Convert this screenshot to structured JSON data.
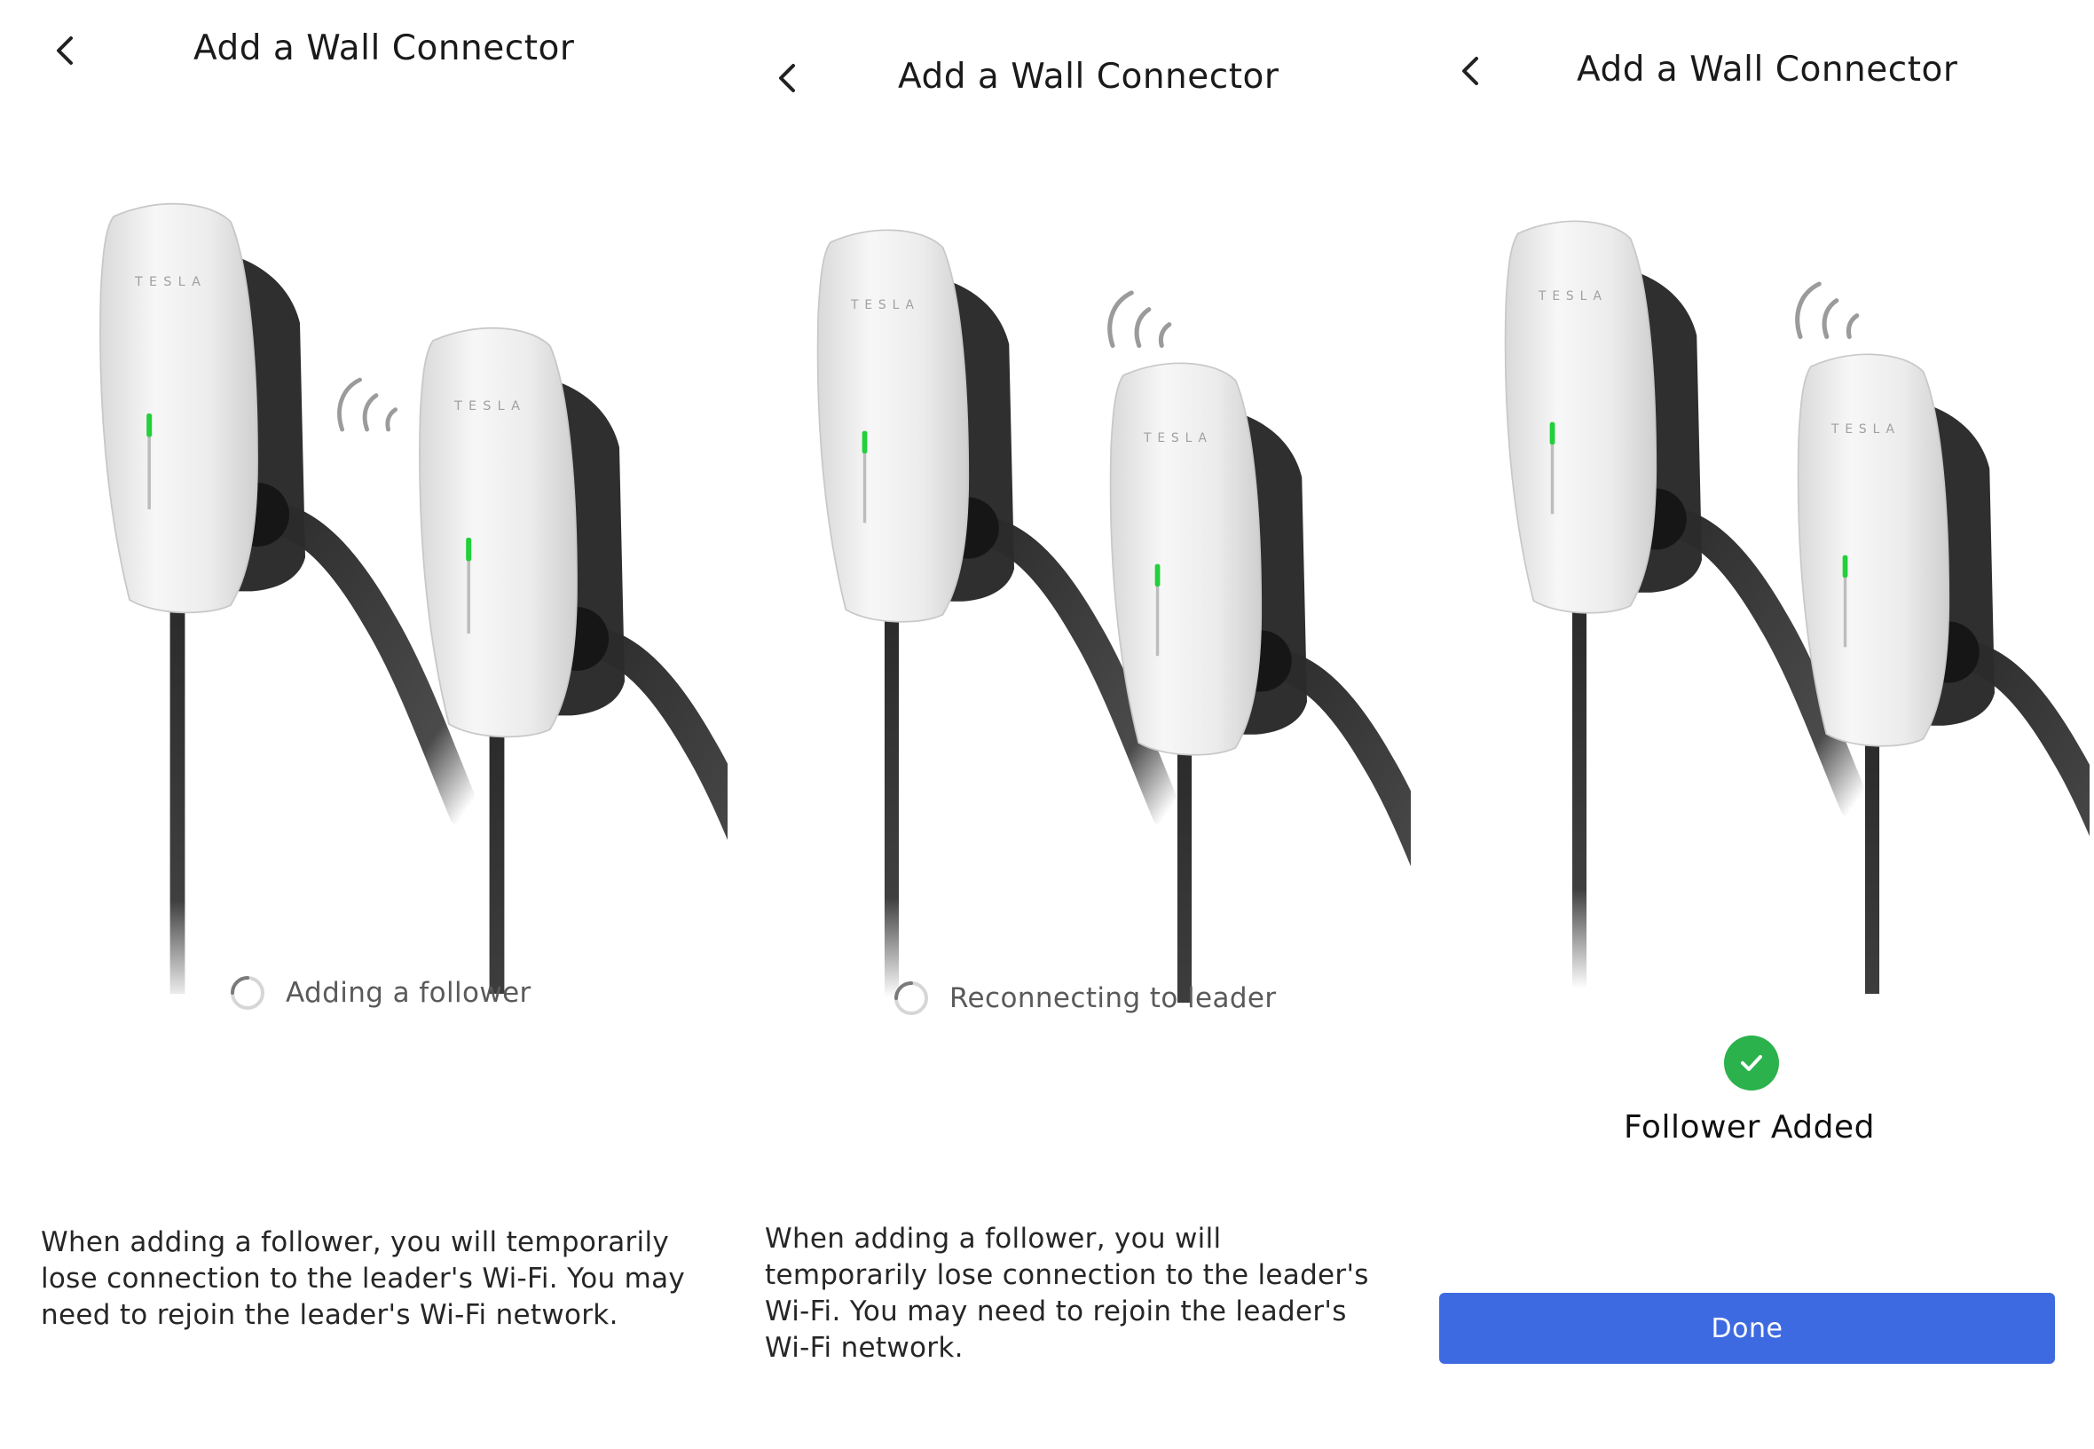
{
  "panels": [
    {
      "header": {
        "title": "Add a Wall Connector",
        "back_icon": "chevron-left-icon"
      },
      "status": {
        "text": "Adding a follower",
        "icon": "loading-spinner-icon"
      },
      "description": "When adding a follower, you will temporarily lose connection to the leader's Wi-Fi. You may need to rejoin the leader's Wi-Fi network."
    },
    {
      "header": {
        "title": "Add a Wall Connector",
        "back_icon": "chevron-left-icon"
      },
      "status": {
        "text": "Reconnecting to leader",
        "icon": "loading-spinner-icon"
      },
      "description": "When adding a follower, you will temporarily lose connection to the leader's Wi-Fi. You may need to rejoin the leader's Wi-Fi network."
    },
    {
      "header": {
        "title": "Add a Wall Connector",
        "back_icon": "chevron-left-icon"
      },
      "result": {
        "text": "Follower Added",
        "icon": "checkmark-circle-icon",
        "color": "#2bb24c"
      },
      "done_label": "Done"
    }
  ],
  "illustration": {
    "brand": "TESLA",
    "led_color": "#22d03a",
    "icon": "wifi-signal-icon"
  },
  "colors": {
    "primary": "#3e6ae1",
    "success": "#2bb24c"
  }
}
